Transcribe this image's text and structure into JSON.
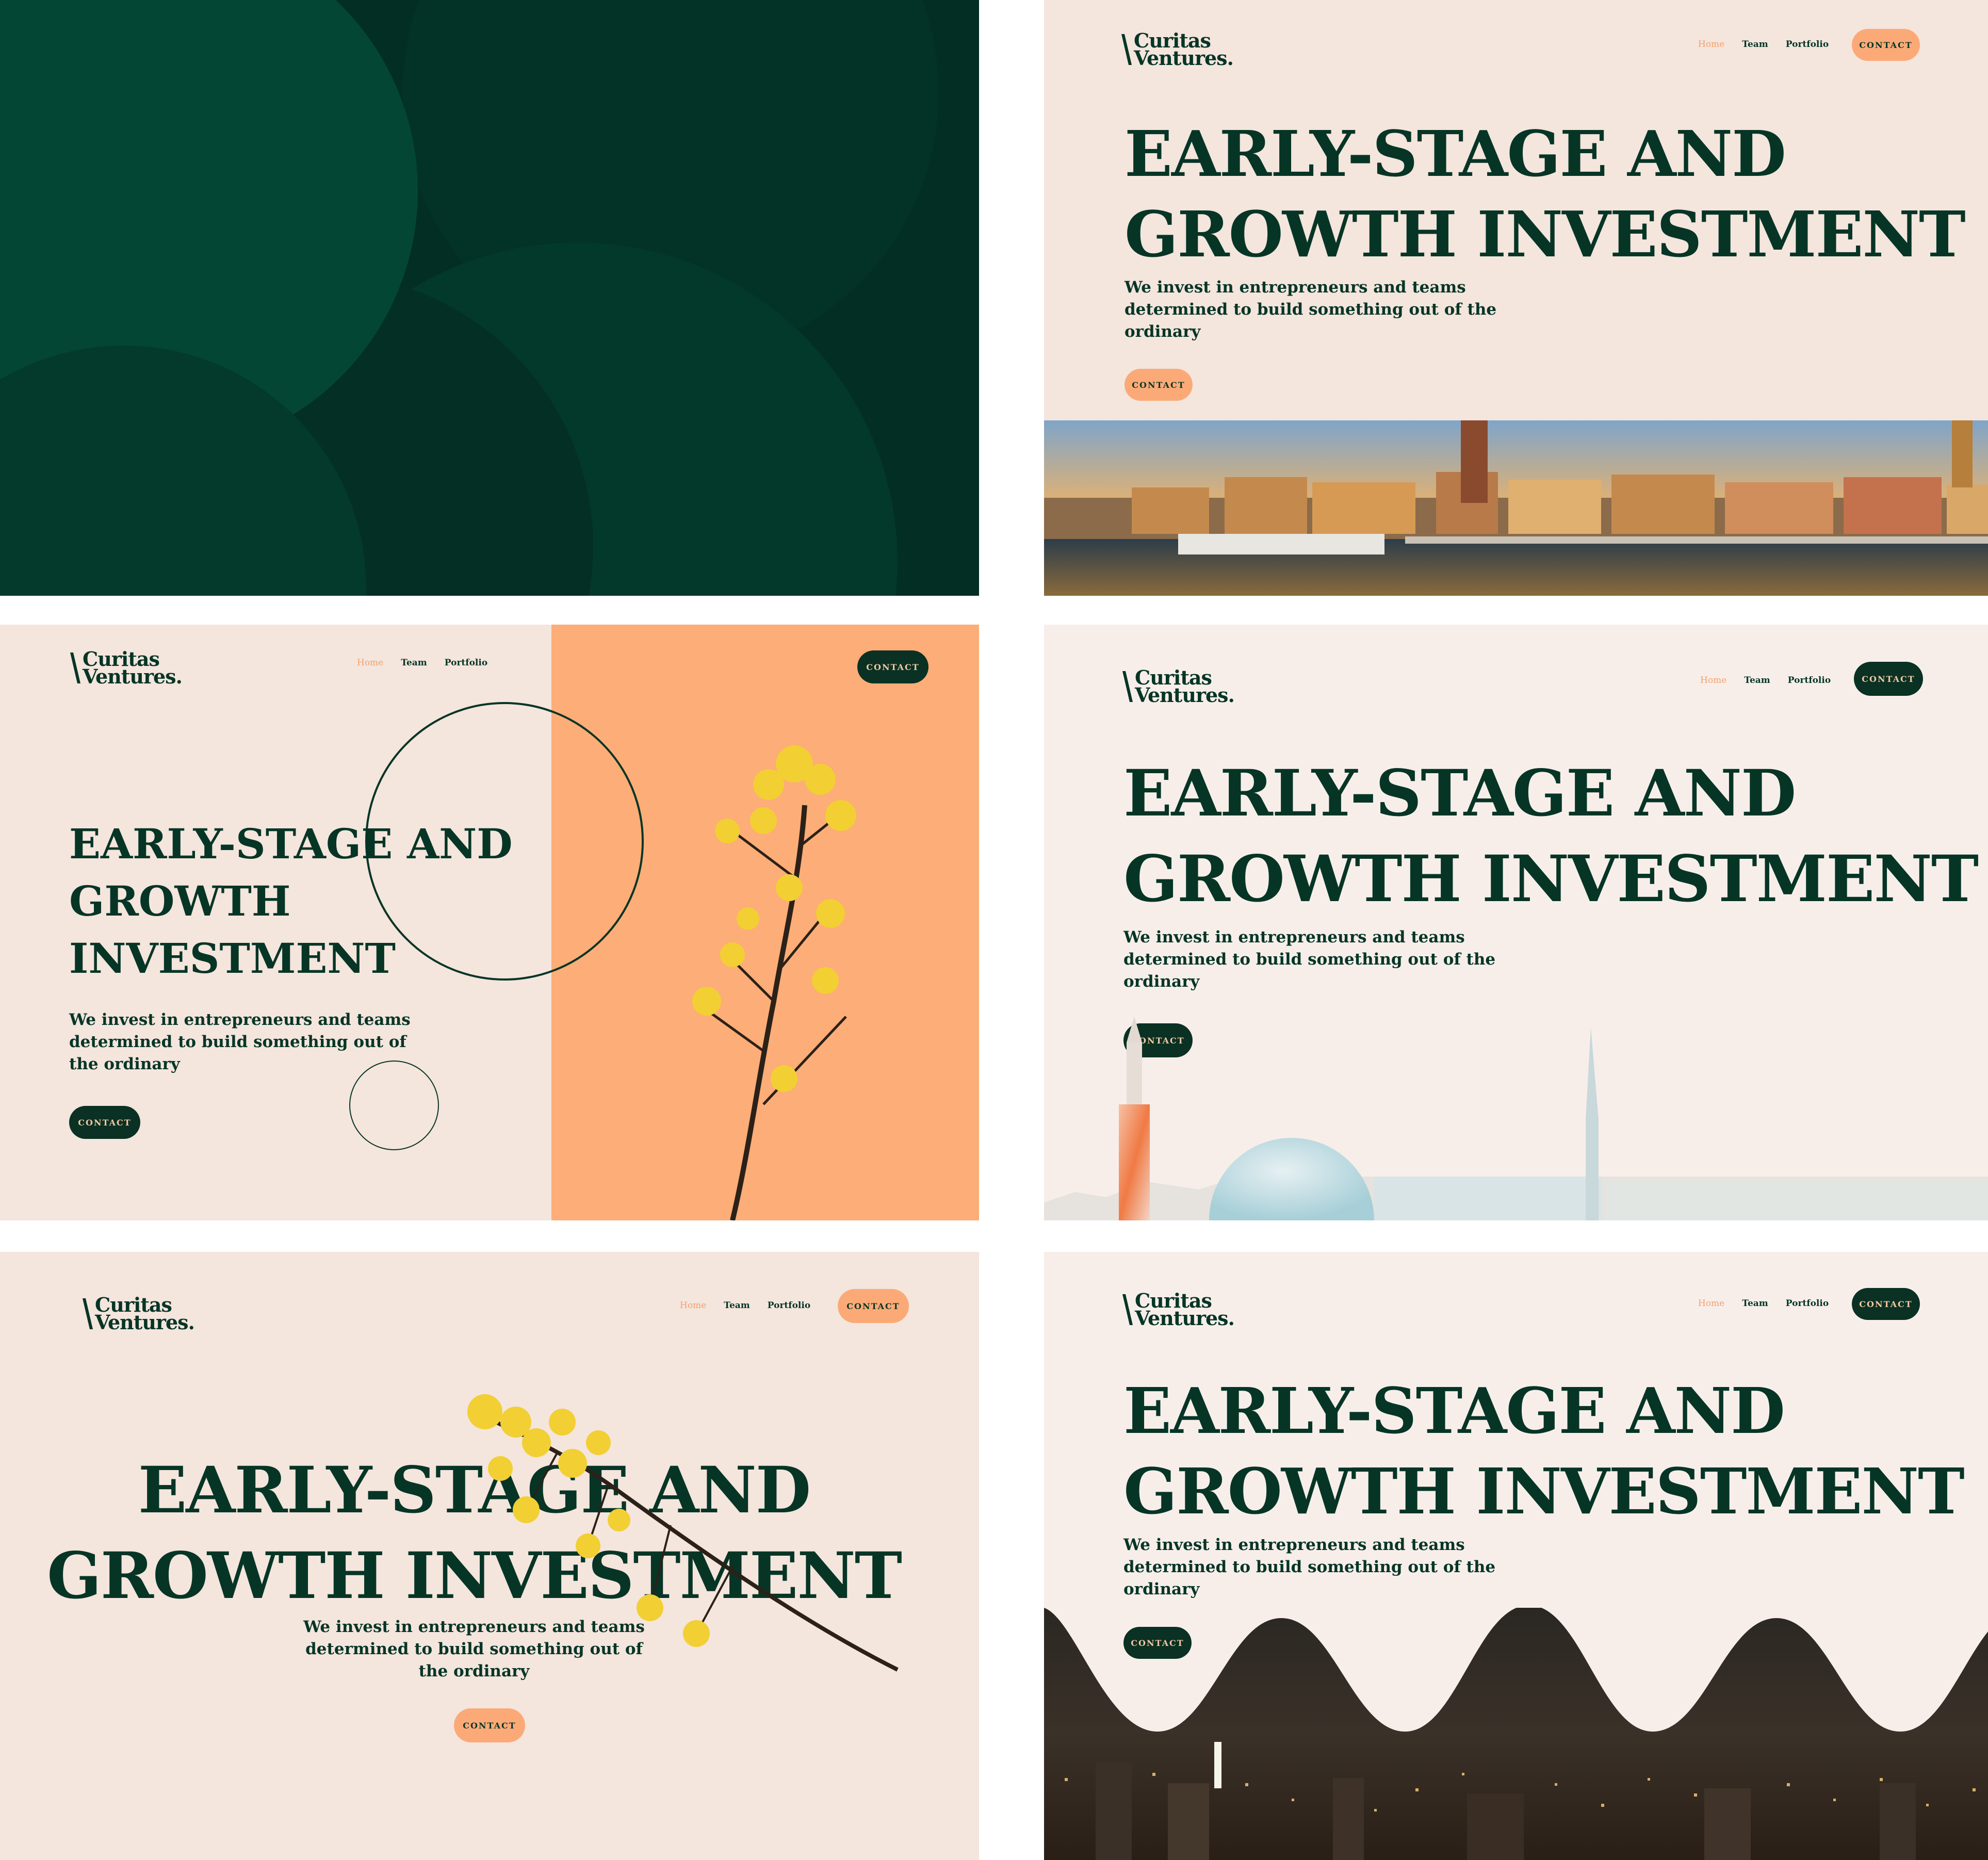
{
  "brand": {
    "line1": "Curitas",
    "line2": "Ventures."
  },
  "nav": {
    "home": "Home",
    "team": "Team",
    "portfolio": "Portfolio",
    "contact": "CONTACT"
  },
  "hero": {
    "headline_line1": "EARLY-STAGE AND",
    "headline_line2": "GROWTH INVESTMENT",
    "headline_alt1": "EARLY-STAGE AND",
    "headline_alt2": "GROWTH",
    "headline_alt3": "INVESTMENT",
    "subtitle_a1": "We invest in entrepreneurs and teams",
    "subtitle_a2": "determined to build something out of the",
    "subtitle_a3": "ordinary",
    "subtitle_b2": "determined to build something out of",
    "subtitle_b3": "the ordinary",
    "cta": "CONTACT"
  },
  "colors": {
    "dark_green": "#063526",
    "peach": "#fbaa77",
    "cream": "#f4e5dd",
    "light_cream": "#f7eeea"
  },
  "images": {
    "city_photo": "stockholm-old-town-sunset",
    "flower": "yellow-rapeseed-flower",
    "skyline": "watercolor-stockholm-skyline",
    "night_city": "night-city-lights"
  }
}
